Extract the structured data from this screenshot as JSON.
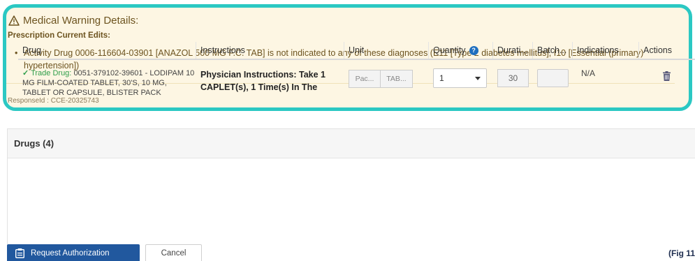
{
  "warning": {
    "title": "Medical Warning Details:",
    "subtitle": "Prescription Current Edits:",
    "items": [
      "Activity Drug 0006-116604-03901 [ANAZOL 500 MG F.C. TAB] is not indicated to any of these diagnoses (E11 [Type 2 diabetes mellitus], I10 [Essential (primary) hypertension])"
    ],
    "response_label": "ResponseId :",
    "response_id": "CCE-20325743",
    "accent_color": "#2bc8c3"
  },
  "drugs": {
    "heading": "Drugs (4)",
    "columns": [
      "Drug",
      "Instructions",
      "Unit",
      "Quantity",
      "Durati...",
      "Batch...",
      "Indications",
      "Actions"
    ],
    "rows": [
      {
        "check": "✓",
        "kind": "Trade Drug:",
        "code": "0051-379102-39601 -",
        "description": "LODIPAM 10 MG FILM-COATED TABLET, 30'S, 10 MG, TABLET OR CAPSULE, BLISTER PACK",
        "instructions": "Physician Instructions: Take 1 CAPLET(s), 1 Time(s) In The",
        "unit_package": "Pac...",
        "unit_type": "TAB...",
        "quantity": "1",
        "duration": "30",
        "batch": "",
        "indications": "N/A",
        "action_icon": "trash-icon"
      }
    ]
  },
  "footer": {
    "primary_label": "Request Authorization",
    "cancel_label": "Cancel",
    "fig_label": "(Fig 11"
  }
}
